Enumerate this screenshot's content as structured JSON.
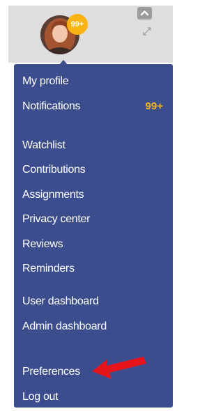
{
  "user": {
    "notification_badge": "99+"
  },
  "menu": {
    "items": [
      {
        "label": "My profile"
      },
      {
        "label": "Notifications",
        "count": "99+"
      },
      {
        "label": "Watchlist"
      },
      {
        "label": "Contributions"
      },
      {
        "label": "Assignments"
      },
      {
        "label": "Privacy center"
      },
      {
        "label": "Reviews"
      },
      {
        "label": "Reminders"
      },
      {
        "label": "User dashboard"
      },
      {
        "label": "Admin dashboard"
      },
      {
        "label": "Preferences"
      },
      {
        "label": "Log out"
      }
    ]
  },
  "icons": {
    "avatar": "profile-photo",
    "collapse": "chevron-up-icon",
    "expand": "expand-arrows-icon",
    "annotation": "red-arrow-icon"
  },
  "colors": {
    "menu_background": "#3b4d8c",
    "badge": "#f9b413",
    "annotation_arrow": "#e8141c"
  }
}
